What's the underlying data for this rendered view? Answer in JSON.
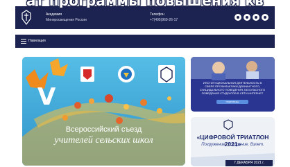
{
  "banner": {
    "text": "ат программы повышения кв"
  },
  "header": {
    "org_title": "Академия",
    "org_subtitle": "Минпросвещения России",
    "phone_title": "Телефон",
    "phone_value": "+7(495)969-26-17",
    "socials": [
      "vk-icon",
      "telegram-icon",
      "ok-icon",
      "youtube-icon"
    ]
  },
  "nav": {
    "label": "Навигация"
  },
  "main_banner": {
    "roman": "V",
    "line1": "Всероссийский съезд",
    "line2": "учителей сельских школ"
  },
  "card1": {
    "text": "ИНСТИТУЦИОНАЛЬНАЯ ДЕЯТЕЛЬНОСТЬ В СФЕРЕ ПРОФИЛАКТИКИ ДЕВИАНТНОГО, СУИЦИДАЛЬНОГО ПОВЕДЕНИЯ, БЕЗОПАСНОГО ПОВЕДЕНИЯ СТУДЕНТОВ В СЕТИ ИНТЕРНЕТ",
    "button": "ПОДРОБНЕЕ"
  },
  "card2": {
    "title": "«ЦИФРОВОЙ ТРИАТЛОН 2021»",
    "subtitle": "Погружение. Ускорение. Взлет.",
    "date": "7 ДЕКАБРЯ 2021 г."
  },
  "colors": {
    "navy": "#1c2350",
    "sky": "#3ea7d8",
    "card_blue": "#2a3592",
    "maple_orange": "#f08a1c"
  }
}
